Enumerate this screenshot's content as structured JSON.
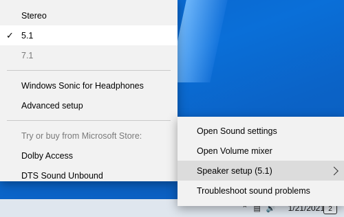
{
  "speaker_menu": {
    "items": [
      {
        "label": "Stereo",
        "state": "normal"
      },
      {
        "label": "5.1",
        "state": "selected",
        "checked": true
      },
      {
        "label": "7.1",
        "state": "disabled"
      },
      {
        "label": "Windows Sonic for Headphones",
        "state": "normal"
      },
      {
        "label": "Advanced setup",
        "state": "normal"
      },
      {
        "label": "Try or buy from Microsoft Store:",
        "state": "disabled"
      },
      {
        "label": "Dolby Access",
        "state": "normal"
      },
      {
        "label": "DTS Sound Unbound",
        "state": "normal"
      }
    ],
    "check_glyph": "✓"
  },
  "sound_menu": {
    "items": [
      {
        "label": "Open Sound settings"
      },
      {
        "label": "Open Volume mixer"
      },
      {
        "label": "Speaker setup (5.1)",
        "has_submenu": true
      },
      {
        "label": "Troubleshoot sound problems"
      }
    ]
  },
  "taskbar": {
    "date": "1/21/2021",
    "notification_count": "2",
    "tray_icons": [
      "chevron-up-icon",
      "network-icon",
      "volume-icon"
    ]
  },
  "colors": {
    "desktop": "#0a62c9",
    "menu_bg": "#f2f2f2",
    "selected_bg": "#ffffff",
    "hover_bg": "#dcdcdc",
    "disabled_text": "#7a7a7a"
  }
}
